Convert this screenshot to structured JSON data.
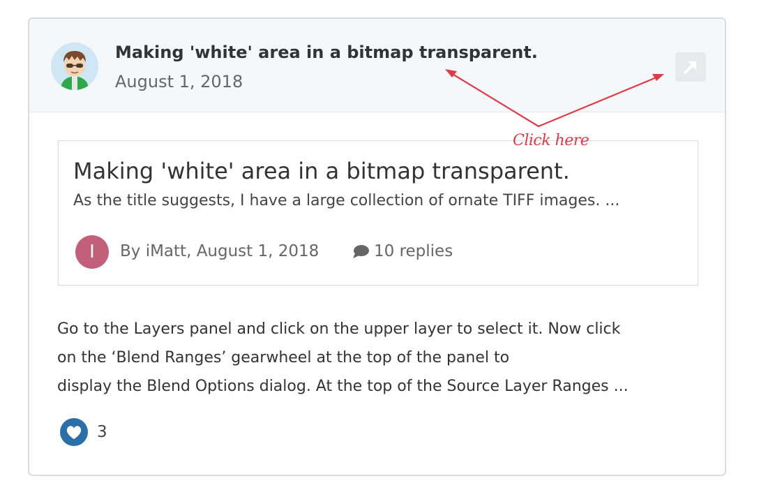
{
  "post": {
    "title": "Making 'white' area in a bitmap transparent.",
    "date": "August 1, 2018"
  },
  "embed": {
    "title": "Making 'white' area in a bitmap transparent.",
    "snippet": "As the title suggests, I have a large collection of ornate TIFF images. ...",
    "author_initial": "I",
    "byline": "By iMatt, August 1, 2018",
    "replies": "10 replies"
  },
  "body": {
    "lines": [
      "Go to the Layers panel and click on the upper layer to select it. Now click",
      "on the ‘Blend Ranges’ gearwheel at the top of the panel to",
      "display the Blend Options dialog. At the top of the Source Layer Ranges ..."
    ]
  },
  "reaction": {
    "icon": "heart-icon",
    "count": "3"
  },
  "annotation": {
    "label": "Click here",
    "color": "#e23a45"
  },
  "colors": {
    "header_bg": "#f5f8fb",
    "author_avatar": "#c2607a",
    "like_blue": "#2a6fa8"
  }
}
